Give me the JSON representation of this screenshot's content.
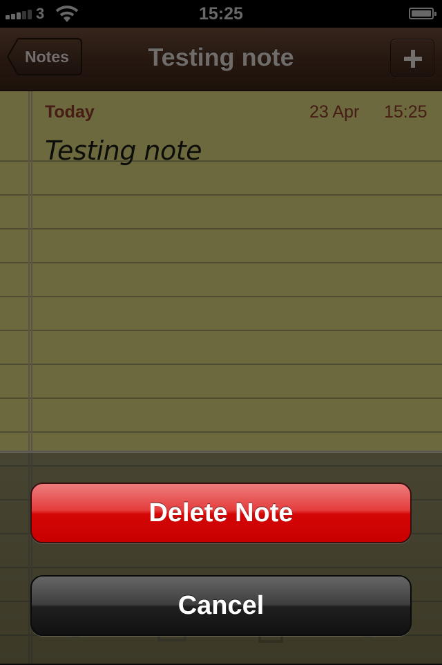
{
  "status_bar": {
    "carrier": "3",
    "time": "15:25"
  },
  "nav": {
    "back_label": "Notes",
    "title": "Testing note",
    "add_icon": "plus-icon"
  },
  "note": {
    "day": "Today",
    "date": "23 Apr",
    "time": "15:25",
    "body": "Testing note"
  },
  "toolbar_icons": [
    "compass-icon",
    "compose-icon",
    "trash-icon",
    "forward-icon"
  ],
  "action_sheet": {
    "delete_label": "Delete Note",
    "cancel_label": "Cancel"
  },
  "colors": {
    "paper": "#d8d37e",
    "date_text": "#8b3b28",
    "nav_bar": "#4a2e20",
    "delete_red": "#d40606"
  }
}
